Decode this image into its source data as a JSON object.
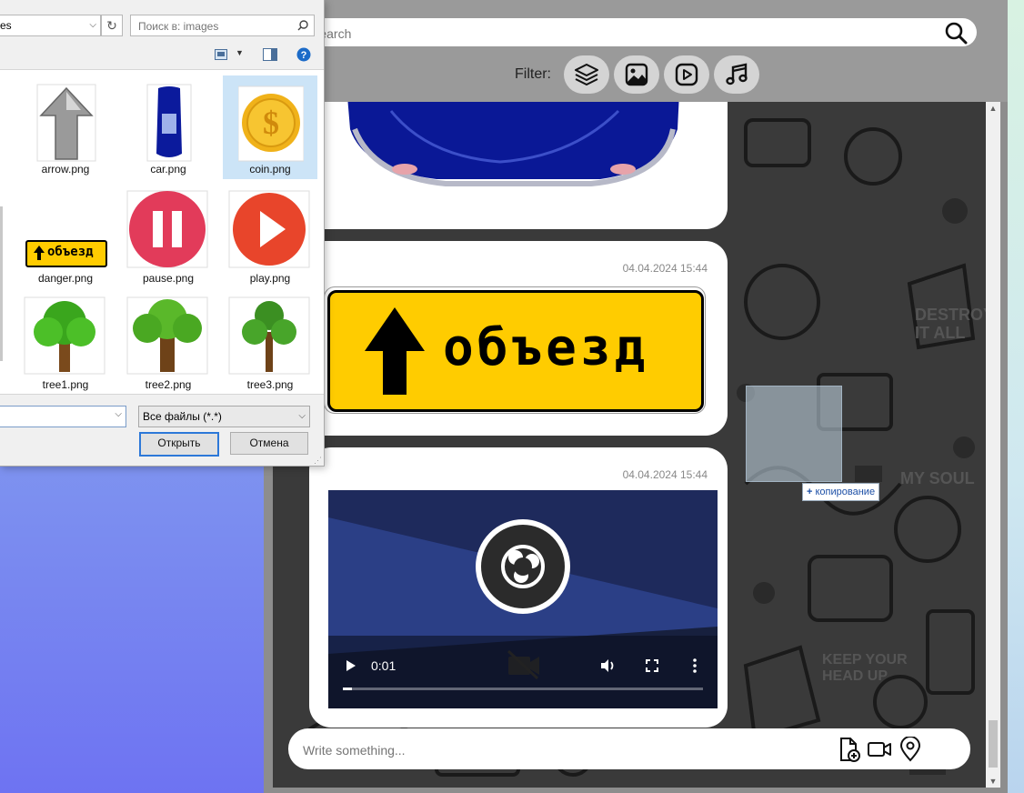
{
  "search": {
    "placeholder": "Search"
  },
  "filter": {
    "label": "Filter:",
    "buttons": [
      "all-layers-icon",
      "image-icon",
      "video-icon",
      "music-icon"
    ]
  },
  "messages": [
    {
      "type": "image",
      "content": "car"
    },
    {
      "type": "image",
      "time": "04.04.2024 15:44",
      "sign_text": "объезд"
    },
    {
      "type": "video",
      "time": "04.04.2024 15:44",
      "video_time": "0:01"
    }
  ],
  "composer": {
    "placeholder": "Write something..."
  },
  "drag": {
    "copy_label": "копирование"
  },
  "dialog": {
    "path_fragment": "es",
    "search_placeholder": "Поиск в: images",
    "files": [
      {
        "name": "arrow.png"
      },
      {
        "name": "car.png"
      },
      {
        "name": "coin.png",
        "selected": true
      },
      {
        "name": "danger.png",
        "sign_text": "объезд"
      },
      {
        "name": "pause.png"
      },
      {
        "name": "play.png"
      },
      {
        "name": "tree1.png"
      },
      {
        "name": "tree2.png"
      },
      {
        "name": "tree3.png"
      }
    ],
    "filetype": "Все файлы (*.*)",
    "open_button": "Открыть",
    "cancel_button": "Отмена"
  },
  "colors": {
    "accent": "#2c78d8",
    "sign_yellow": "#ffcc00",
    "pause_red": "#e23b5a",
    "play_red": "#e8452b"
  }
}
